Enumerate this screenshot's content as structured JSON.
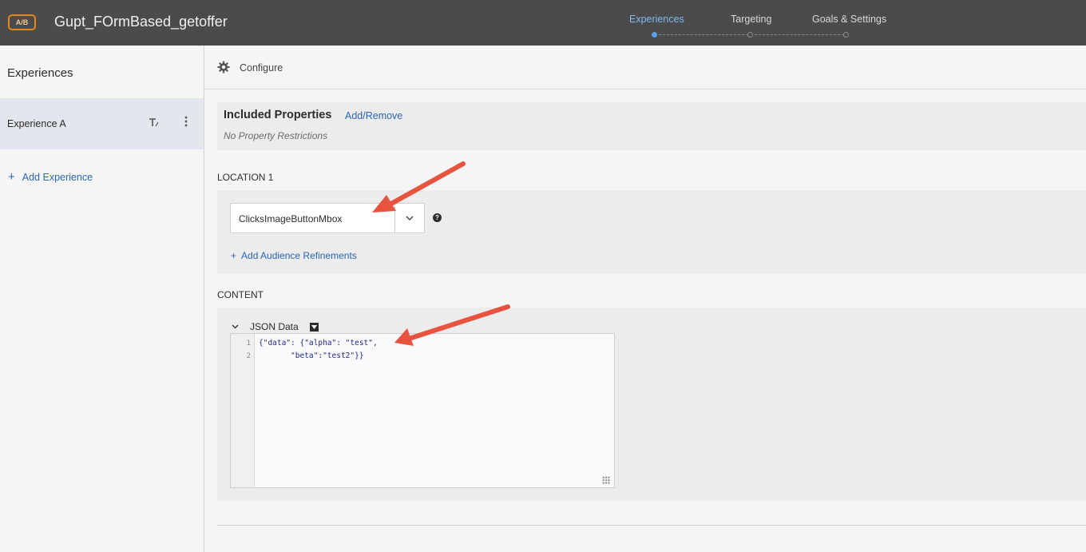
{
  "header": {
    "badge": "A/B",
    "activity_name": "Gupt_FOrmBased_getoffer",
    "steps": [
      {
        "label": "Experiences",
        "active": true
      },
      {
        "label": "Targeting",
        "active": false
      },
      {
        "label": "Goals & Settings",
        "active": false
      }
    ]
  },
  "sidebar": {
    "heading": "Experiences",
    "experiences": [
      {
        "label": "Experience A",
        "selected": true
      }
    ],
    "add_label": "Add Experience",
    "plus": "+"
  },
  "main": {
    "configure_label": "Configure",
    "properties": {
      "title": "Included Properties",
      "link": "Add/Remove",
      "subtitle": "No Property Restrictions"
    },
    "location": {
      "label": "LOCATION 1",
      "mbox_value": "ClicksImageButtonMbox",
      "help": "?",
      "add_refinements": "Add Audience Refinements",
      "plus": "+"
    },
    "content": {
      "label": "CONTENT",
      "json_label": "JSON Data",
      "code_lines": [
        {
          "num": "1",
          "text": "{\"data\": {\"alpha\": \"test\","
        },
        {
          "num": "2",
          "text": "       \"beta\":\"test2\"}}"
        }
      ]
    }
  },
  "annotations": {
    "arrow_color": "#e8533f"
  },
  "colors": {
    "topbar": "#4b4b4b",
    "accent": "#2a65b3",
    "active_step": "#7fb9f0",
    "badge_border": "#e68619"
  }
}
